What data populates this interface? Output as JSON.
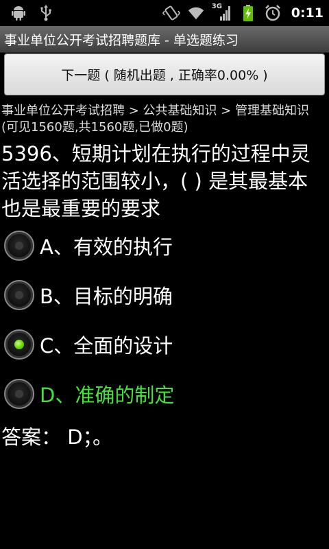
{
  "status_bar": {
    "time": "0:11",
    "network_label": "3G",
    "icons": [
      "android-icon",
      "usb-icon",
      "vibrate-icon",
      "wifi-icon",
      "signal-3g-icon",
      "battery-charging-icon",
      "alarm-icon"
    ]
  },
  "app": {
    "title": "事业单位公开考试招聘题库  -  单选题练习"
  },
  "next_button": {
    "label": "下一题 ( 随机出题 , 正确率0.00% )"
  },
  "breadcrumb": {
    "text": "事业单位公开考试招聘 > 公共基础知识 > 管理基础知识 (可见1560题,共1560题,已做0题)"
  },
  "question": {
    "text": "5396、短期计划在执行的过程中灵活选择的范围较小，(    ) 是其最基本也是最重要的要求"
  },
  "options": [
    {
      "label": "A、有效的执行",
      "selected": false,
      "correct": false
    },
    {
      "label": "B、目标的明确",
      "selected": false,
      "correct": false
    },
    {
      "label": "C、全面的设计",
      "selected": true,
      "correct": false
    },
    {
      "label": "D、准确的制定",
      "selected": false,
      "correct": true
    }
  ],
  "answer": {
    "text": "答案：  D；。"
  },
  "colors": {
    "background": "#000000",
    "correct": "#45e03a",
    "selected_radio": "#5fd000"
  }
}
